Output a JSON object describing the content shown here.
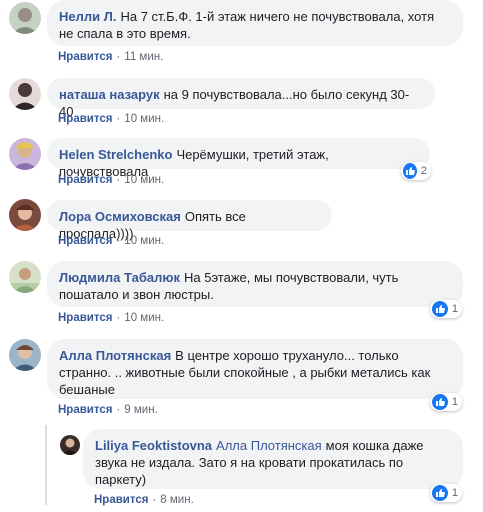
{
  "like_label": "Нравится",
  "comments": [
    {
      "author": "Нелли Л.",
      "text": "На 7 ст.Б.Ф. 1-й этаж ничего не почувствовала, хотя не спала в это время.",
      "time": "11 мин.",
      "reactions": ""
    },
    {
      "author": "наташа назарук",
      "text": "на 9 почувствовала...но было секунд 30-40",
      "time": "10 мин.",
      "reactions": ""
    },
    {
      "author": "Helen Strelchenko",
      "text": "Черёмушки, третий этаж, почувствовала",
      "time": "10 мин.",
      "reactions": "2"
    },
    {
      "author": "Лора Осмиховская",
      "text": "Опять все проспала))))",
      "time": "10 мин.",
      "reactions": ""
    },
    {
      "author": "Людмила Табалюк",
      "text": "На 5этаже, мы почувствовали, чуть пошатало и звон люстры.",
      "time": "10 мин.",
      "reactions": "1"
    },
    {
      "author": "Алла Плотянская",
      "text": "В центре хорошо трухануло... только странно. .. животные были спокойные , а рыбки метались как бешаные",
      "time": "9 мин.",
      "reactions": "1"
    }
  ],
  "reply": {
    "author": "Liliya Feoktistovna",
    "mention": "Алла Плотянская",
    "text": "моя кошка даже звука не издала. Зато я на кровати прокатилась по паркету)",
    "time": "8 мин.",
    "reactions": "1"
  },
  "colors": {
    "link": "#385898",
    "bubble": "#f2f3f5",
    "like": "#1877f2",
    "meta": "#606770"
  }
}
